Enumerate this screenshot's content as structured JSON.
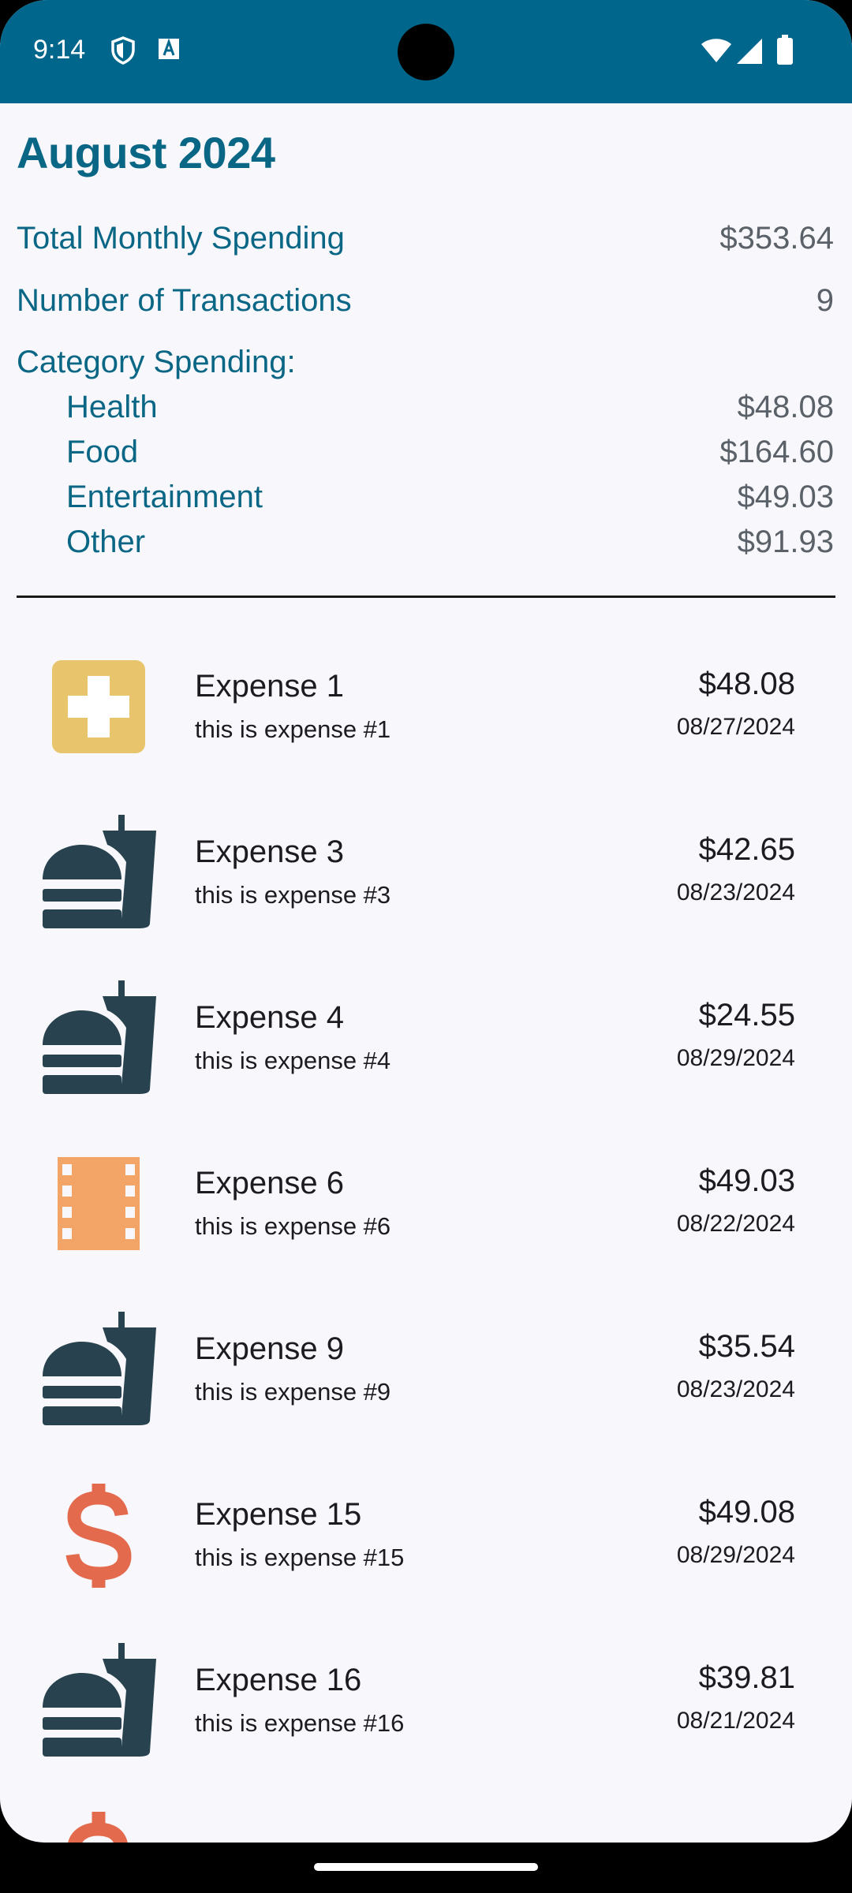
{
  "status_bar": {
    "time": "9:14",
    "icons": [
      "shield-icon",
      "font-a-icon",
      "wifi-icon",
      "signal-icon",
      "battery-icon"
    ],
    "color": "#00668b"
  },
  "summary": {
    "month_title": "August 2024",
    "total_label": "Total Monthly Spending",
    "total_value": "$353.64",
    "count_label": "Number of Transactions",
    "count_value": "9",
    "category_heading": "Category Spending:",
    "categories": [
      {
        "label": "Health",
        "value": "$48.08"
      },
      {
        "label": "Food",
        "value": "$164.60"
      },
      {
        "label": "Entertainment",
        "value": "$49.03"
      },
      {
        "label": "Other",
        "value": "$91.93"
      }
    ]
  },
  "expenses": [
    {
      "title": "Expense 1",
      "desc": "this is expense #1",
      "amount": "$48.08",
      "date": "08/27/2024",
      "icon": "health-cross-icon",
      "icon_color": "#e8c46c"
    },
    {
      "title": "Expense 3",
      "desc": "this is expense #3",
      "amount": "$42.65",
      "date": "08/23/2024",
      "icon": "fastfood-icon",
      "icon_color": "#28434f"
    },
    {
      "title": "Expense 4",
      "desc": "this is expense #4",
      "amount": "$24.55",
      "date": "08/29/2024",
      "icon": "fastfood-icon",
      "icon_color": "#28434f"
    },
    {
      "title": "Expense 6",
      "desc": "this is expense #6",
      "amount": "$49.03",
      "date": "08/22/2024",
      "icon": "film-icon",
      "icon_color": "#f2a566"
    },
    {
      "title": "Expense 9",
      "desc": "this is expense #9",
      "amount": "$35.54",
      "date": "08/23/2024",
      "icon": "fastfood-icon",
      "icon_color": "#28434f"
    },
    {
      "title": "Expense 15",
      "desc": "this is expense #15",
      "amount": "$49.08",
      "date": "08/29/2024",
      "icon": "dollar-icon",
      "icon_color": "#e46a4e"
    },
    {
      "title": "Expense 16",
      "desc": "this is expense #16",
      "amount": "$39.81",
      "date": "08/21/2024",
      "icon": "fastfood-icon",
      "icon_color": "#28434f"
    }
  ],
  "colors": {
    "accent": "#0a6685",
    "value_grey": "#5a6168",
    "background": "#f8f8fc"
  }
}
